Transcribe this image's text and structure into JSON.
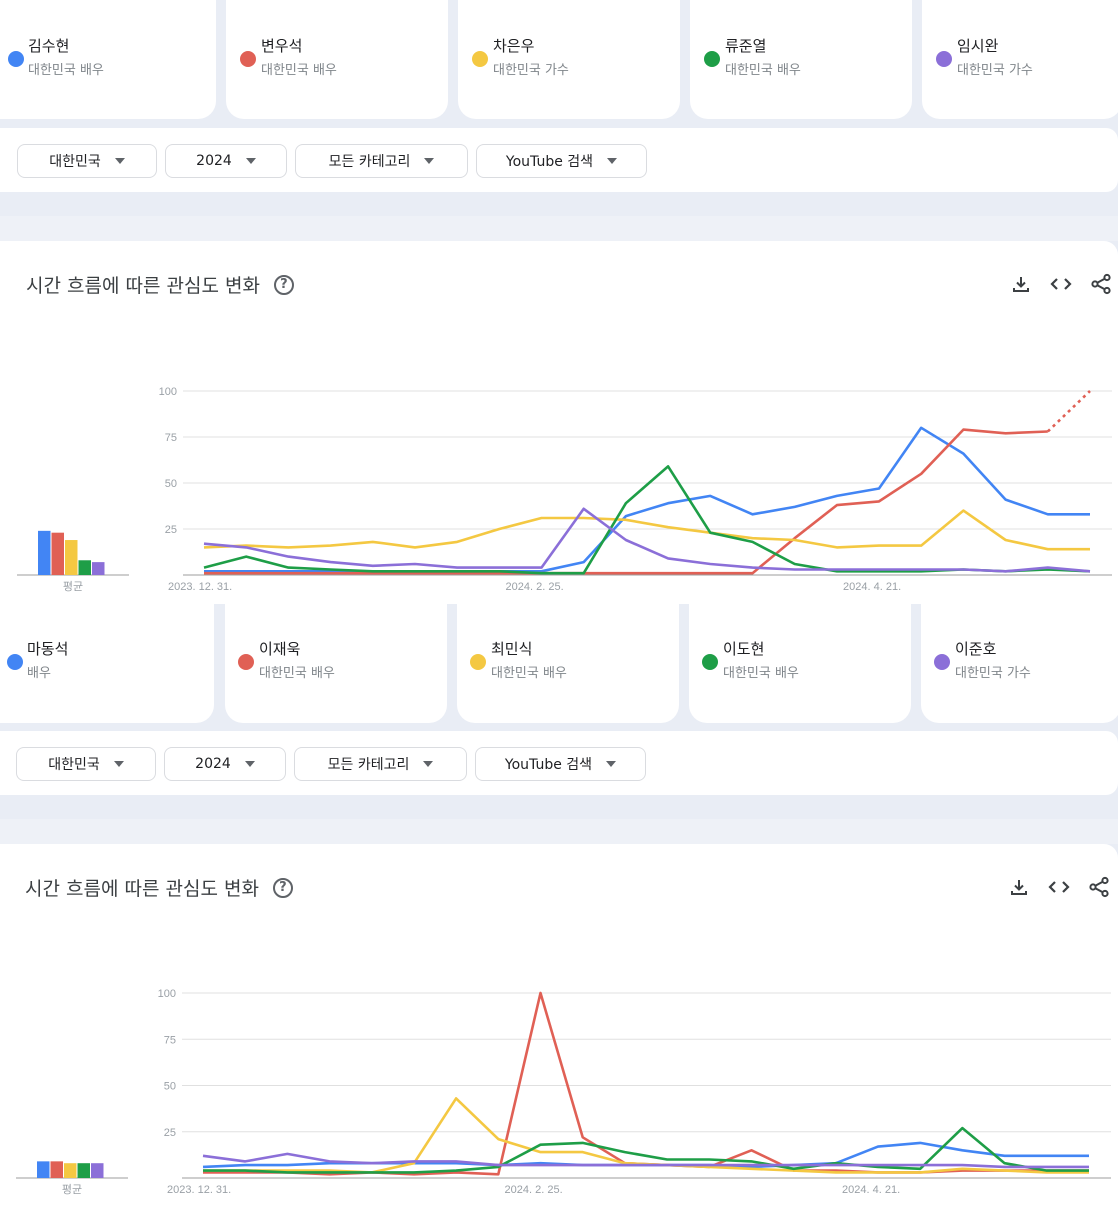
{
  "colors": {
    "blue": "#4285f4",
    "red": "#e06055",
    "yellow": "#f4c842",
    "green": "#1e9e47",
    "purple": "#8b6fd8"
  },
  "sections": [
    {
      "terms": [
        {
          "name": "김수현",
          "sub": "대한민국 배우",
          "color": "#4285f4"
        },
        {
          "name": "변우석",
          "sub": "대한민국 배우",
          "color": "#e06055"
        },
        {
          "name": "차은우",
          "sub": "대한민국 가수",
          "color": "#f4c842"
        },
        {
          "name": "류준열",
          "sub": "대한민국 배우",
          "color": "#1e9e47"
        },
        {
          "name": "임시완",
          "sub": "대한민국 가수",
          "color": "#8b6fd8"
        }
      ],
      "filters": {
        "region": "대한민국",
        "year": "2024",
        "category": "모든 카테고리",
        "source": "YouTube 검색"
      },
      "panel_title": "시간 흐름에 따른 관심도 변화",
      "help": "?"
    },
    {
      "terms": [
        {
          "name": "마동석",
          "sub": "배우",
          "color": "#4285f4"
        },
        {
          "name": "이재욱",
          "sub": "대한민국 배우",
          "color": "#e06055"
        },
        {
          "name": "최민식",
          "sub": "대한민국 배우",
          "color": "#f4c842"
        },
        {
          "name": "이도현",
          "sub": "대한민국 배우",
          "color": "#1e9e47"
        },
        {
          "name": "이준호",
          "sub": "대한민국 가수",
          "color": "#8b6fd8"
        }
      ],
      "filters": {
        "region": "대한민국",
        "year": "2024",
        "category": "모든 카테고리",
        "source": "YouTube 검색"
      },
      "panel_title": "시간 흐름에 따른 관심도 변화",
      "help": "?"
    }
  ],
  "chart_data": [
    {
      "type": "line",
      "title": "시간 흐름에 따른 관심도 변화",
      "ylim": [
        0,
        100
      ],
      "yticks": [
        25,
        50,
        75,
        100
      ],
      "xtick_labels": [
        {
          "index": 0,
          "label": "2023. 12. 31."
        },
        {
          "index": 8,
          "label": "2024. 2. 25."
        },
        {
          "index": 16,
          "label": "2024. 4. 21."
        }
      ],
      "grid": true,
      "avg_label": "평균",
      "averages": [
        24,
        23,
        19,
        8,
        7
      ],
      "series": [
        {
          "name": "김수현",
          "color": "#4285f4",
          "values": [
            2,
            2,
            2,
            2,
            2,
            2,
            2,
            2,
            2,
            7,
            32,
            39,
            43,
            33,
            37,
            43,
            47,
            80,
            66,
            41,
            33,
            33
          ]
        },
        {
          "name": "변우석",
          "color": "#e06055",
          "values": [
            1,
            1,
            1,
            1,
            1,
            1,
            1,
            1,
            1,
            1,
            1,
            1,
            1,
            1,
            20,
            38,
            40,
            55,
            79,
            77,
            78,
            100
          ],
          "partial_last": true
        },
        {
          "name": "차은우",
          "color": "#f4c842",
          "values": [
            15,
            16,
            15,
            16,
            18,
            15,
            18,
            25,
            31,
            31,
            30,
            26,
            23,
            20,
            19,
            15,
            16,
            16,
            35,
            19,
            14,
            14
          ]
        },
        {
          "name": "류준열",
          "color": "#1e9e47",
          "values": [
            4,
            10,
            4,
            3,
            2,
            2,
            2,
            2,
            1,
            1,
            39,
            59,
            23,
            18,
            6,
            2,
            2,
            2,
            3,
            2,
            3,
            2
          ]
        },
        {
          "name": "임시완",
          "color": "#8b6fd8",
          "values": [
            17,
            15,
            10,
            7,
            5,
            6,
            4,
            4,
            4,
            36,
            19,
            9,
            6,
            4,
            3,
            3,
            3,
            3,
            3,
            2,
            4,
            2
          ]
        }
      ]
    },
    {
      "type": "line",
      "title": "시간 흐름에 따른 관심도 변화",
      "ylim": [
        0,
        100
      ],
      "yticks": [
        25,
        50,
        75,
        100
      ],
      "xtick_labels": [
        {
          "index": 0,
          "label": "2023. 12. 31."
        },
        {
          "index": 8,
          "label": "2024. 2. 25."
        },
        {
          "index": 16,
          "label": "2024. 4. 21."
        }
      ],
      "grid": true,
      "avg_label": "평균",
      "averages": [
        9,
        9,
        8,
        8,
        8
      ],
      "series": [
        {
          "name": "마동석",
          "color": "#4285f4",
          "values": [
            6,
            7,
            7,
            8,
            8,
            8,
            8,
            7,
            8,
            7,
            7,
            7,
            7,
            6,
            7,
            8,
            17,
            19,
            15,
            12,
            12,
            12
          ]
        },
        {
          "name": "이재욱",
          "color": "#e06055",
          "values": [
            3,
            3,
            3,
            2,
            3,
            2,
            3,
            2,
            100,
            22,
            8,
            7,
            6,
            15,
            4,
            4,
            3,
            3,
            4,
            4,
            4,
            4
          ]
        },
        {
          "name": "최민식",
          "color": "#f4c842",
          "values": [
            4,
            4,
            4,
            4,
            3,
            8,
            43,
            21,
            14,
            14,
            8,
            7,
            6,
            5,
            4,
            3,
            3,
            3,
            5,
            4,
            3,
            3
          ]
        },
        {
          "name": "이도현",
          "color": "#1e9e47",
          "values": [
            4,
            4,
            3,
            3,
            3,
            3,
            4,
            6,
            18,
            19,
            14,
            10,
            10,
            9,
            5,
            8,
            6,
            5,
            27,
            8,
            4,
            4
          ]
        },
        {
          "name": "이준호",
          "color": "#8b6fd8",
          "values": [
            12,
            9,
            13,
            9,
            8,
            9,
            9,
            7,
            7,
            7,
            7,
            7,
            7,
            7,
            7,
            7,
            7,
            7,
            7,
            6,
            6,
            6
          ]
        }
      ]
    }
  ]
}
